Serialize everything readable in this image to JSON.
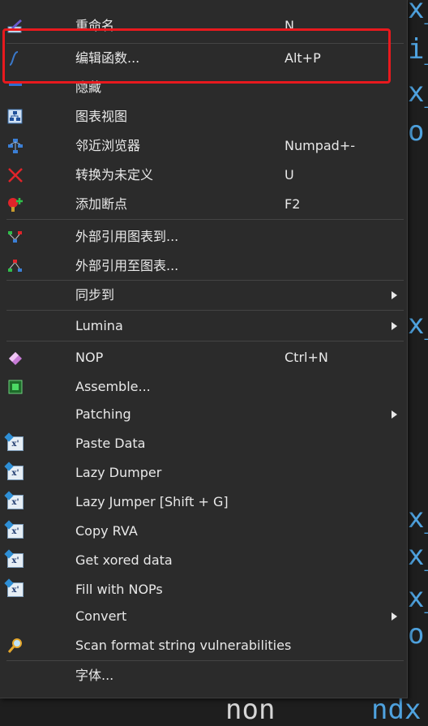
{
  "background_code": {
    "right_fragments": [
      "x_",
      "i_",
      "x_",
      "or",
      "x_",
      "x_",
      "x_",
      "x_",
      "x_",
      "or"
    ],
    "bottom_left": "non",
    "bottom_right": "ndx"
  },
  "menu": {
    "items": [
      {
        "label": "重命名",
        "shortcut": "N",
        "icon": "rename-icon"
      },
      {
        "label": "编辑函数...",
        "shortcut": "Alt+P",
        "icon": "edit-function-icon"
      },
      {
        "label": "隐藏",
        "shortcut": "",
        "icon": "hide-icon"
      },
      {
        "label": "图表视图",
        "shortcut": "",
        "icon": "graph-view-icon"
      },
      {
        "label": "邻近浏览器",
        "shortcut": "Numpad+-",
        "icon": "proximity-browser-icon"
      },
      {
        "label": "转换为未定义",
        "shortcut": "U",
        "icon": "undefine-icon"
      },
      {
        "label": "添加断点",
        "shortcut": "F2",
        "icon": "breakpoint-icon"
      },
      {
        "label": "外部引用图表到...",
        "shortcut": "",
        "icon": "xrefs-to-graph-icon"
      },
      {
        "label": "外部引用至图表...",
        "shortcut": "",
        "icon": "xrefs-from-graph-icon"
      },
      {
        "label": "同步到",
        "shortcut": "",
        "icon": ""
      },
      {
        "label": "Lumina",
        "shortcut": "",
        "icon": ""
      },
      {
        "label": "NOP",
        "shortcut": "Ctrl+N",
        "icon": "eraser-icon"
      },
      {
        "label": "Assemble...",
        "shortcut": "",
        "icon": "assemble-icon"
      },
      {
        "label": "Patching",
        "shortcut": "",
        "icon": ""
      },
      {
        "label": "Paste Data",
        "shortcut": "",
        "icon": "script-icon"
      },
      {
        "label": "Lazy Dumper",
        "shortcut": "",
        "icon": "script-icon"
      },
      {
        "label": "Lazy Jumper [Shift + G]",
        "shortcut": "",
        "icon": "script-icon"
      },
      {
        "label": "Copy RVA",
        "shortcut": "",
        "icon": "script-icon"
      },
      {
        "label": "Get xored data",
        "shortcut": "",
        "icon": "script-icon"
      },
      {
        "label": "Fill with NOPs",
        "shortcut": "",
        "icon": "script-icon"
      },
      {
        "label": "Convert",
        "shortcut": "",
        "icon": ""
      },
      {
        "label": "Scan format string vulnerabilities",
        "shortcut": "",
        "icon": "magnifier-icon"
      },
      {
        "label": "字体...",
        "shortcut": "",
        "icon": ""
      }
    ]
  },
  "colors": {
    "highlight_box": "#e8191e",
    "menu_bg": "#2b2b2b",
    "text": "#e8e8e8"
  }
}
